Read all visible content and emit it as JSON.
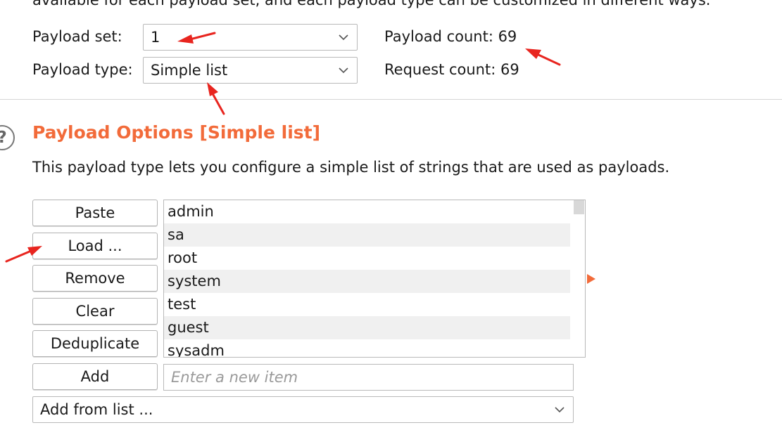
{
  "header": {
    "cut_text": "available for each payload set, and each payload type can be customized in different ways."
  },
  "payload_set": {
    "label": "Payload set:",
    "value": "1"
  },
  "payload_type": {
    "label": "Payload type:",
    "value": "Simple list"
  },
  "payload_count": {
    "text": "Payload count: 69"
  },
  "request_count": {
    "text": "Request count: 69"
  },
  "options": {
    "title": "Payload Options [Simple list]",
    "description": "This payload type lets you configure a simple list of strings that are used as payloads."
  },
  "buttons": {
    "paste": "Paste",
    "load": "Load ...",
    "remove": "Remove",
    "clear": "Clear",
    "deduplicate": "Deduplicate",
    "add": "Add"
  },
  "list_items": [
    "admin",
    "sa",
    "root",
    "system",
    "test",
    "guest",
    "sysadm"
  ],
  "new_item": {
    "placeholder": "Enter a new item"
  },
  "add_from_list": {
    "value": "Add from list ..."
  },
  "colors": {
    "accent": "#f26b3a",
    "arrow": "#e8251f"
  },
  "icons": {
    "help": "question-circle-icon",
    "dropdown": "chevron-down-icon"
  }
}
